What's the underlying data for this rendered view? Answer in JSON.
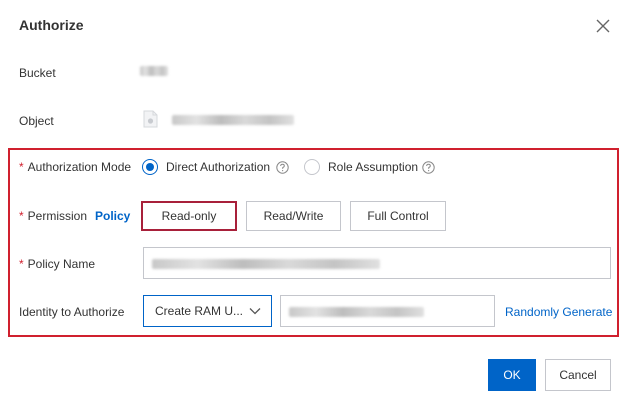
{
  "dialog": {
    "title": "Authorize"
  },
  "bucket": {
    "label": "Bucket"
  },
  "object": {
    "label": "Object"
  },
  "authorization_mode": {
    "label": "Authorization Mode",
    "options": [
      {
        "label": "Direct Authorization",
        "selected": true
      },
      {
        "label": "Role Assumption",
        "selected": false
      }
    ]
  },
  "permission": {
    "label": "Permission",
    "policy_link": "Policy",
    "options": [
      {
        "label": "Read-only",
        "selected": true
      },
      {
        "label": "Read/Write",
        "selected": false
      },
      {
        "label": "Full Control",
        "selected": false
      }
    ]
  },
  "policy_name": {
    "label": "Policy Name"
  },
  "identity": {
    "label": "Identity to Authorize",
    "select_value": "Create RAM U...",
    "random_link": "Randomly Generate"
  },
  "footer": {
    "ok_label": "OK",
    "cancel_label": "Cancel"
  },
  "colors": {
    "primary": "#0064c8",
    "required": "#d0202e",
    "highlight_box": "#d0202e",
    "selected_permission_border": "#a8203a"
  },
  "icons": {
    "close": "close-icon",
    "help": "question-circle-icon",
    "file": "file-icon",
    "chevron": "chevron-down-icon"
  }
}
